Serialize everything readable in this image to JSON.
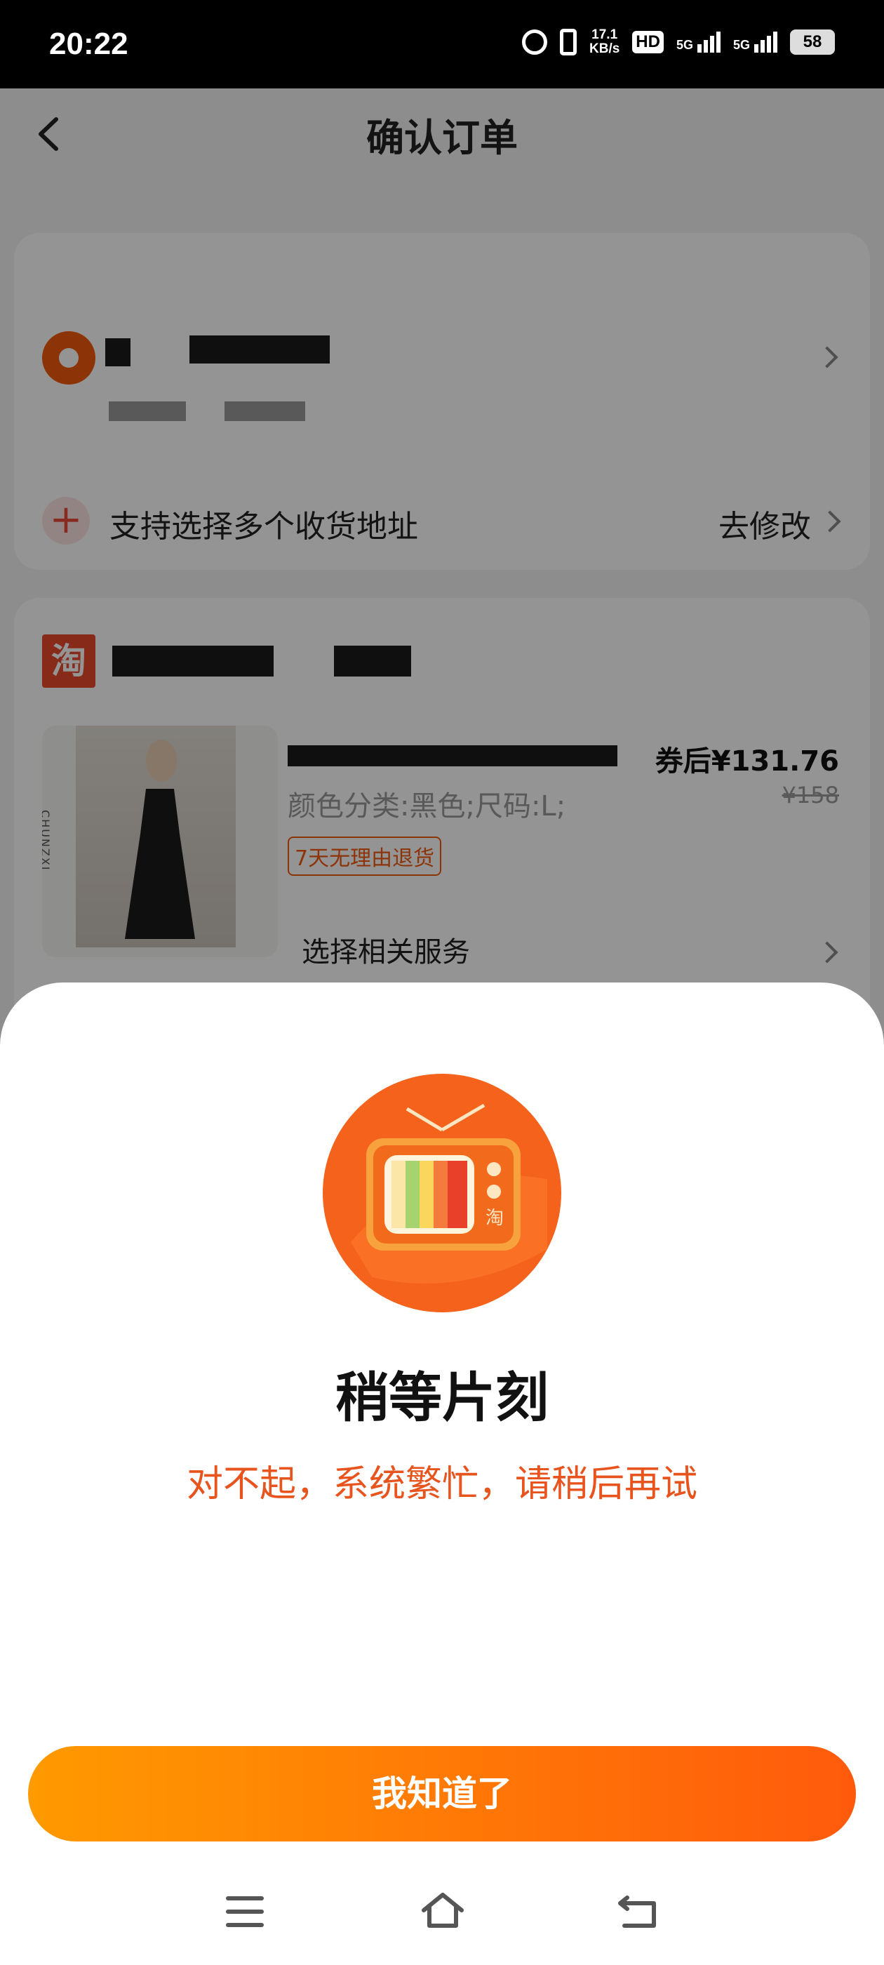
{
  "status_bar": {
    "time": "20:22",
    "net_speed_value": "17.1",
    "net_speed_unit": "KB/s",
    "hd_label": "HD",
    "signal_1_label": "5G",
    "signal_2_label": "5G",
    "battery": "58"
  },
  "header": {
    "title": "确认订单",
    "back_icon": "chevron-left-icon"
  },
  "address_card": {
    "location_icon": "location-pin-icon",
    "multi_address_label": "支持选择多个收货地址",
    "modify_label": "去修改"
  },
  "shop_card": {
    "shop_icon_text": "淘",
    "thumb_brand": "CHUNZXI",
    "variant": "颜色分类:黑色;尺码:L;",
    "return_badge": "7天无理由退货",
    "price_after_coupon": "券后¥131.76",
    "price_original": "¥158",
    "service_label": "选择相关服务"
  },
  "modal": {
    "illustration": "retro-tv-icon",
    "tv_logo_text": "淘",
    "title": "稍等片刻",
    "message": "对不起，系统繁忙，请稍后再试",
    "button_label": "我知道了"
  },
  "nav_bar": {
    "icons": [
      "menu-icon",
      "home-icon",
      "back-icon"
    ]
  },
  "colors": {
    "accent_orange": "#ff5a0c",
    "message_orange": "#e8541e",
    "button_gradient_start": "#ff9a00",
    "taobao_red": "#e8492b"
  }
}
